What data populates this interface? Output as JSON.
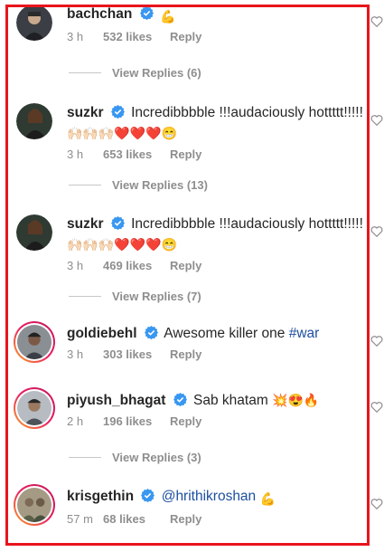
{
  "comments": [
    {
      "username": "bachchan",
      "text": "",
      "trailing_emoji": "💪",
      "time": "3 h",
      "likes": "532 likes",
      "reply": "Reply"
    },
    {
      "username": "suzkr",
      "text": "Incredibbbble !!!audaciously hottttt!!!!!",
      "emojis": "🙌🏻🙌🏻🙌🏻❤️❤️❤️😁",
      "time": "3 h",
      "likes": "653 likes",
      "reply": "Reply"
    },
    {
      "username": "suzkr",
      "text": "Incredibbbble !!!audaciously hottttt!!!!!",
      "emojis": "🙌🏻🙌🏻🙌🏻❤️❤️❤️😁",
      "time": "3 h",
      "likes": "469 likes",
      "reply": "Reply"
    },
    {
      "username": "goldiebehl",
      "text": "Awesome killer one",
      "hashtag": "#war",
      "time": "3 h",
      "likes": "303 likes",
      "reply": "Reply"
    },
    {
      "username": "piyush_bhagat",
      "text": "Sab khatam",
      "emojis": "💥😍🔥",
      "time": "2 h",
      "likes": "196 likes",
      "reply": "Reply"
    },
    {
      "username": "krisgethin",
      "mention": "@hrithikroshan",
      "trailing_emoji": "💪",
      "time": "57 m",
      "likes": "68 likes",
      "reply": "Reply"
    }
  ],
  "view_replies": [
    "View Replies (6)",
    "View Replies (13)",
    "View Replies (7)",
    "View Replies (3)"
  ],
  "colors": {
    "highlight_frame": "#e8141c",
    "verified_badge": "#3897f0",
    "link_blue": "#1d4fa0",
    "meta_gray": "#8e8e8e"
  },
  "icons": {
    "verified": "verified-badge-icon",
    "like": "heart-outline-icon"
  }
}
